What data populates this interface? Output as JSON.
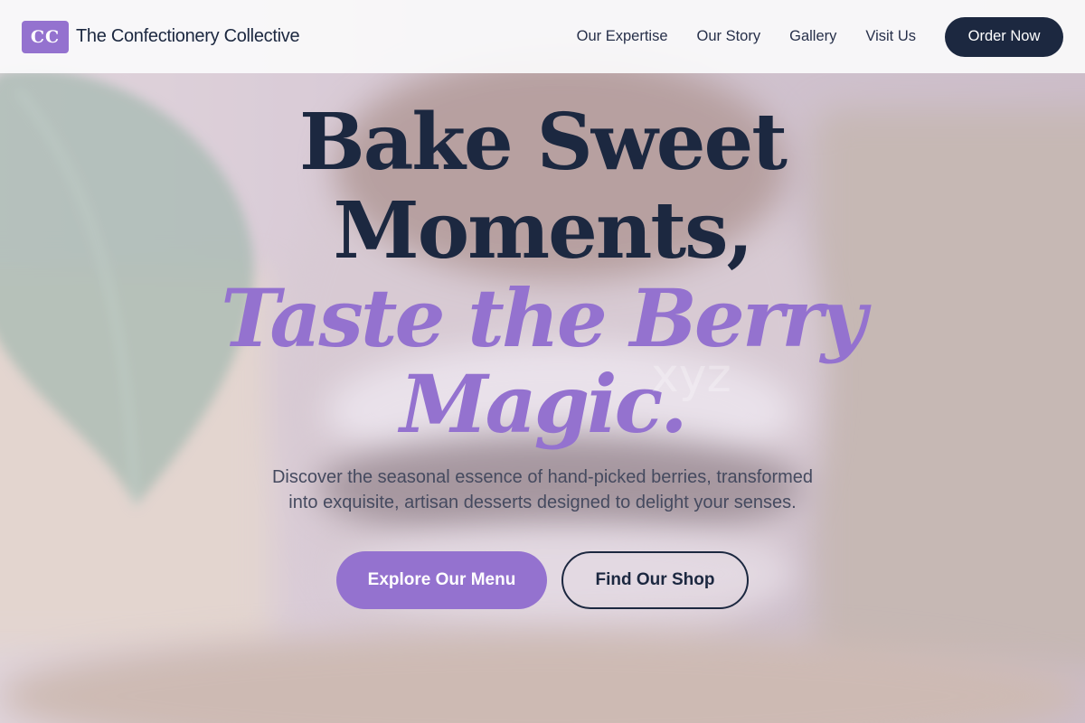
{
  "header": {
    "logo_text": "CC",
    "brand_name": "The Confectionery Collective",
    "nav": [
      "Our Expertise",
      "Our Story",
      "Gallery",
      "Visit Us"
    ],
    "cta": "Order Now"
  },
  "hero": {
    "headline_line1": "Bake Sweet",
    "headline_line2": "Moments,",
    "accent_line1": "Taste the Berry",
    "accent_line2": "Magic.",
    "watermark": "xyz",
    "subtitle_line1": "Discover the seasonal essence of hand-picked berries, transformed",
    "subtitle_line2": "into exquisite, artisan desserts designed to delight your senses.",
    "primary_button": "Explore Our Menu",
    "secondary_button": "Find Our Shop"
  },
  "colors": {
    "brand_dark": "#1c2840",
    "brand_accent": "#9472cf",
    "header_bg": "#fafafb"
  }
}
